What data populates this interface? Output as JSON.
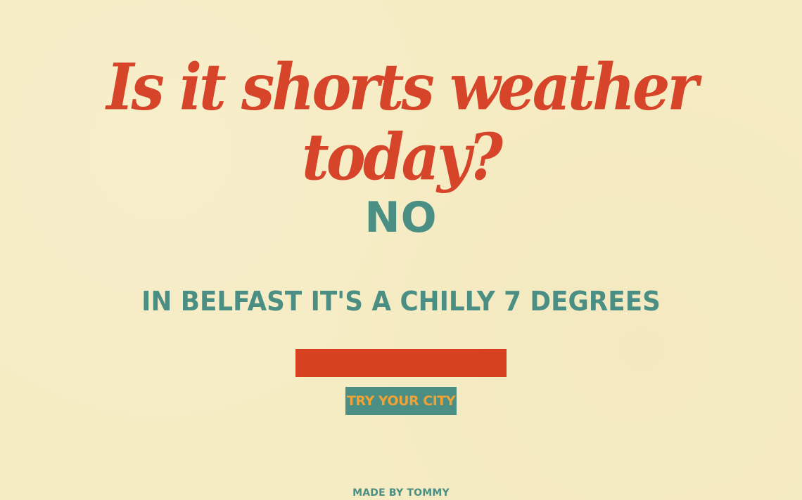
{
  "header": {
    "title": "Is it shorts weather today?"
  },
  "result": {
    "answer": "NO",
    "detail": "IN BELFAST IT'S A CHILLY 7 DEGREES"
  },
  "form": {
    "city_input_value": "",
    "city_input_placeholder": "",
    "submit_label": "TRY YOUR CITY"
  },
  "footer": {
    "credit": "MADE BY TOMMY"
  },
  "colors": {
    "background": "#f6ecc4",
    "accent_red": "#d6452a",
    "accent_teal": "#4b8f84",
    "button_text_orange": "#f0a235"
  }
}
